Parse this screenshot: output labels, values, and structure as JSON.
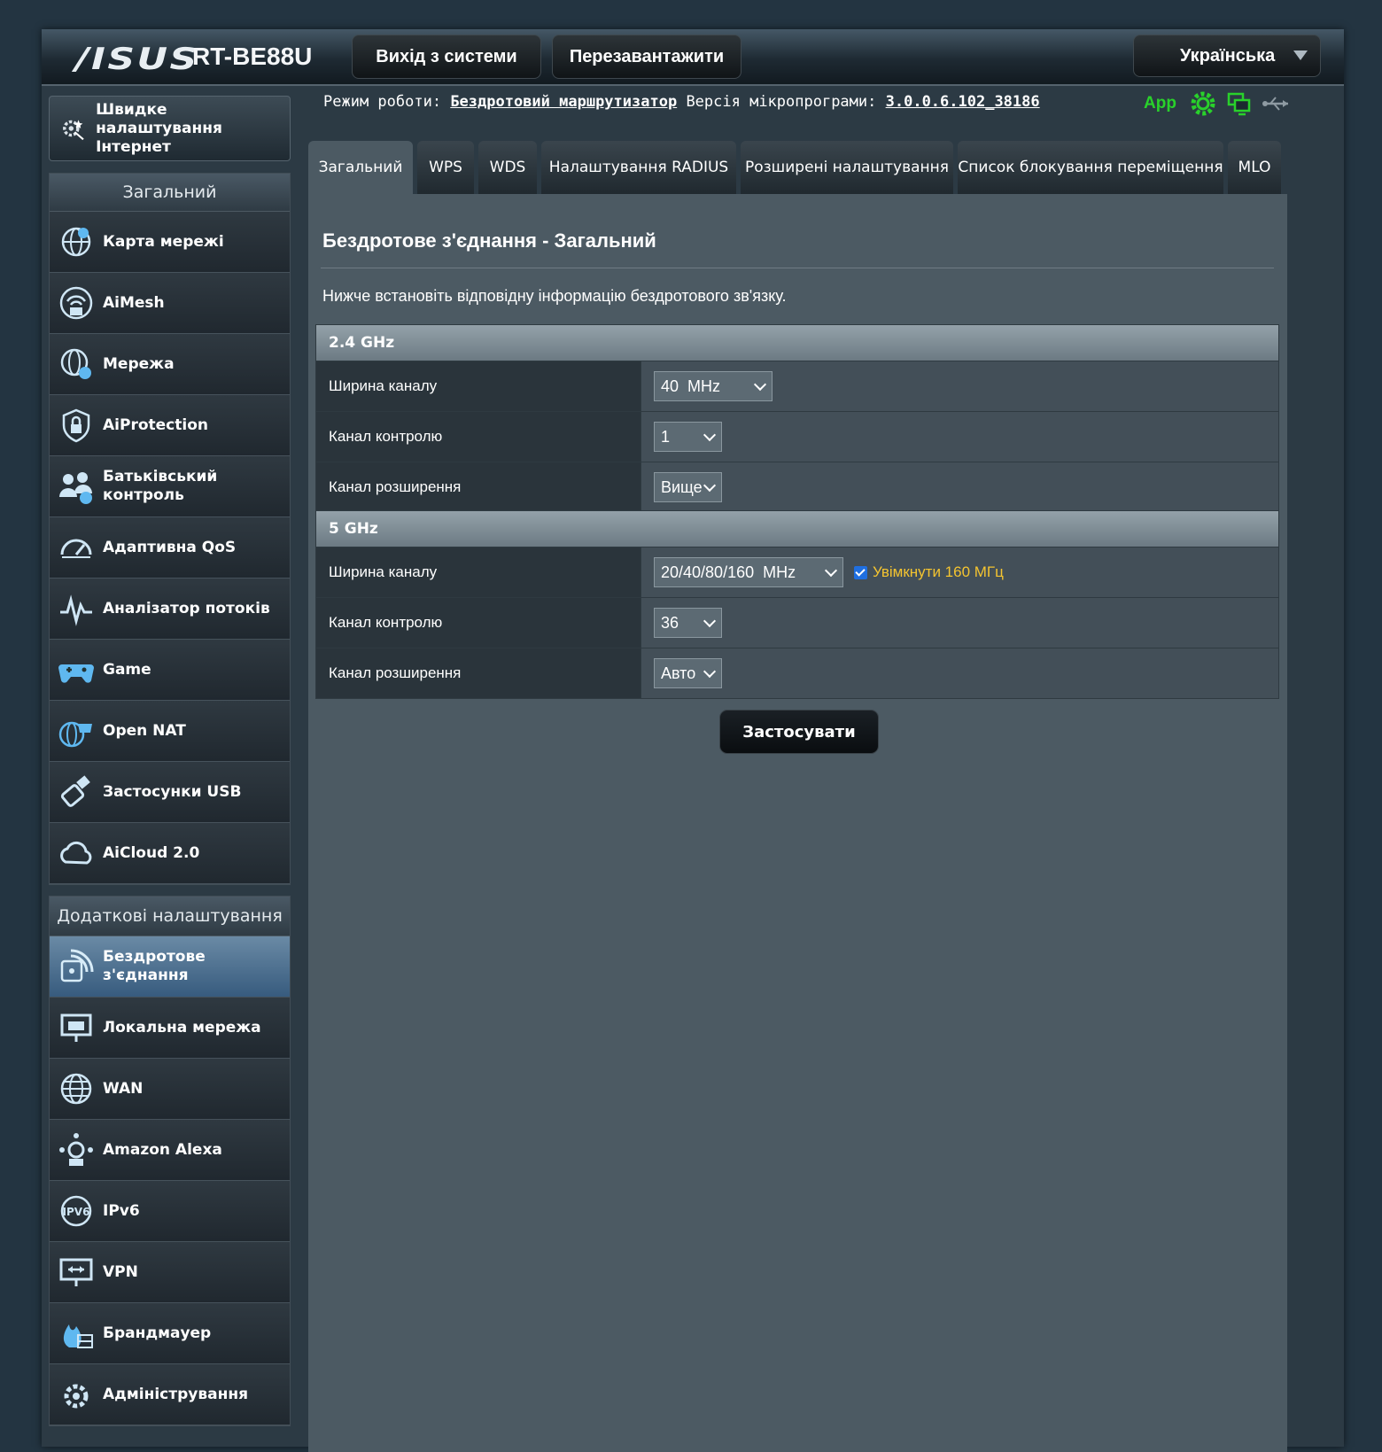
{
  "header": {
    "logo": "/ISUS",
    "model": "RT-BE88U",
    "logout_label": "Вихід з системи",
    "reboot_label": "Перезавантажити",
    "language": "Українська"
  },
  "info": {
    "mode_label": "Режим роботи:",
    "mode_value": "Бездротовий маршрутизатор",
    "fw_label": "Версія мікропрограми:",
    "fw_value": "3.0.0.6.102_38186",
    "app_label": "App"
  },
  "sidebar": {
    "qis_label": "Швидке налаштування Інтернет",
    "general_header": "Загальний",
    "general_items": [
      {
        "label": "Карта мережі",
        "icon": "network-map-icon"
      },
      {
        "label": "AiMesh",
        "icon": "aimesh-icon"
      },
      {
        "label": "Мережа",
        "icon": "network-icon"
      },
      {
        "label": "AiProtection",
        "icon": "aiprotection-icon"
      },
      {
        "label": "Батьківський контроль",
        "icon": "parental-control-icon"
      },
      {
        "label": "Адаптивна QoS",
        "icon": "qos-icon"
      },
      {
        "label": "Аналізатор потоків",
        "icon": "traffic-analyzer-icon"
      },
      {
        "label": "Game",
        "icon": "game-icon"
      },
      {
        "label": "Open NAT",
        "icon": "open-nat-icon"
      },
      {
        "label": "Застосунки USB",
        "icon": "usb-icon"
      },
      {
        "label": "AiCloud 2.0",
        "icon": "aicloud-icon"
      }
    ],
    "advanced_header": "Додаткові налаштування",
    "advanced_items": [
      {
        "label": "Бездротове з'єднання",
        "icon": "wireless-icon",
        "active": true
      },
      {
        "label": "Локальна мережа",
        "icon": "lan-icon"
      },
      {
        "label": "WAN",
        "icon": "wan-icon"
      },
      {
        "label": "Amazon Alexa",
        "icon": "alexa-icon"
      },
      {
        "label": "IPv6",
        "icon": "ipv6-icon"
      },
      {
        "label": "VPN",
        "icon": "vpn-icon"
      },
      {
        "label": "Брандмауер",
        "icon": "firewall-icon"
      },
      {
        "label": "Адміністрування",
        "icon": "administration-icon"
      }
    ]
  },
  "tabs": [
    "Загальний",
    "WPS",
    "WDS",
    "Налаштування RADIUS",
    "Розширені налаштування",
    "Список блокування переміщення",
    "MLO"
  ],
  "main": {
    "title": "Бездротове з'єднання - Загальний",
    "description": "Нижче встановіть відповідну інформацію бездротового зв'язку.",
    "band24": {
      "header": "2.4 GHz",
      "bandwidth_label": "Ширина каналу",
      "bandwidth_value": "40  MHz",
      "control_label": "Канал контролю",
      "control_value": "1",
      "ext_label": "Канал розширення",
      "ext_value": "Вище"
    },
    "band5": {
      "header": "5 GHz",
      "bandwidth_label": "Ширина каналу",
      "bandwidth_value": "20/40/80/160  MHz",
      "enable160_label": "Увімкнути 160 МГц",
      "control_label": "Канал контролю",
      "control_value": "36",
      "ext_label": "Канал розширення",
      "ext_value": "Авто"
    },
    "apply_label": "Застосувати"
  },
  "colors": {
    "accent_green": "#29d12b",
    "checkbox_label": "#f4c430",
    "active_menu": "#4f7396"
  }
}
